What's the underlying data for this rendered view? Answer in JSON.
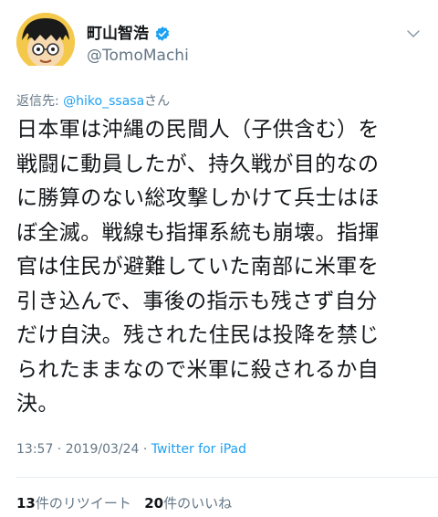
{
  "tweet": {
    "author": {
      "display_name": "町山智浩",
      "handle": "@TomoMachi",
      "verified": true,
      "avatar_icon": "cartoon-avatar-icon"
    },
    "menu_icon": "chevron-down-icon",
    "reply_label": "返信先: ",
    "reply_mention": "@hiko_ssasa",
    "reply_suffix": "さん",
    "text": "日本軍は沖縄の民間人（子供含む）を\n戦闘に動員したが、持久戦が目的なの\nに勝算のない総攻撃しかけて兵士はほ\nぼ全滅。戦線も指揮系統も崩壊。指揮\n官は住民が避難していた南部に米軍を\n引き込んで、事後の指示も残さず自分\nだけ自決。残された住民は投降を禁じ\nられたままなので米軍に殺されるか自\n決。",
    "time": "13:57",
    "separator": " · ",
    "date": "2019/03/24",
    "source": "Twitter for iPad"
  },
  "stats": {
    "retweet_count": "13",
    "retweet_label": "件のリツイート",
    "like_count": "20",
    "like_label": "件のいいね"
  },
  "colors": {
    "link": "#1da1f2",
    "secondary_text": "#657786",
    "primary_text": "#14171a",
    "divider": "#e6ecf0"
  }
}
